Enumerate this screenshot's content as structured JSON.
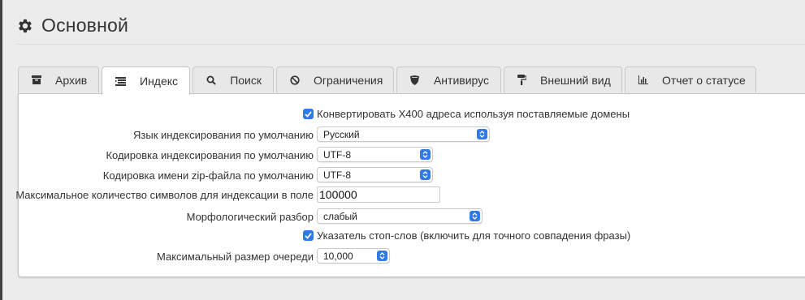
{
  "header": {
    "title": "Основной",
    "icon": "gear-icon"
  },
  "tabs": [
    {
      "label": "Архив",
      "icon": "archive-icon",
      "active": false
    },
    {
      "label": "Индекс",
      "icon": "index-list-icon",
      "active": true
    },
    {
      "label": "Поиск",
      "icon": "search-icon",
      "active": false
    },
    {
      "label": "Ограничения",
      "icon": "ban-icon",
      "active": false
    },
    {
      "label": "Антивирус",
      "icon": "shield-icon",
      "active": false
    },
    {
      "label": "Внешний вид",
      "icon": "paint-roller-icon",
      "active": false
    },
    {
      "label": "Отчет о статусе",
      "icon": "bar-chart-icon",
      "active": false
    }
  ],
  "form": {
    "convert_x400": {
      "label": "Конвертировать X400 адреса используя поставляемые домены",
      "checked": true
    },
    "index_language": {
      "label": "Язык индексирования по умолчанию",
      "value": "Русский"
    },
    "index_encoding": {
      "label": "Кодировка индексирования по умолчанию",
      "value": "UTF-8"
    },
    "zip_encoding": {
      "label": "Кодировка имени zip-файла по умолчанию",
      "value": "UTF-8"
    },
    "max_chars": {
      "label": "Максимальное количество символов для индексации в поле",
      "value": "100000"
    },
    "morphology": {
      "label": "Морфологический разбор",
      "value": "слабый"
    },
    "stopwords": {
      "label": "Указатель стоп-слов (включить для точного совпадения фразы)",
      "checked": true
    },
    "max_queue": {
      "label": "Максимальный размер очереди",
      "value": "10,000"
    }
  },
  "colors": {
    "accent": "#2f7ae5",
    "background": "#ececec",
    "panel": "#ffffff"
  }
}
